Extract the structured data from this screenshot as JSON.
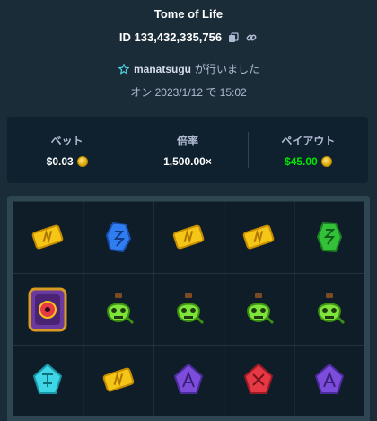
{
  "game": {
    "title": "Tome of Life"
  },
  "bet": {
    "id_label": "ID 133,432,335,756"
  },
  "user": {
    "name": "manatsugu",
    "suffix": "が行いました"
  },
  "date": {
    "text": "オン 2023/1/12 で 15:02"
  },
  "stats": {
    "bet_label": "ベット",
    "bet_value": "$0.03",
    "multiplier_label": "倍率",
    "multiplier_value": "1,500.00×",
    "payout_label": "ペイアウト",
    "payout_value": "$45.00"
  },
  "colors": {
    "background": "#1a2c38",
    "panel": "#0f212e",
    "payout": "#00e701"
  },
  "reels": [
    [
      "gold-rune-icon",
      "book-tome-icon",
      "cyan-rune-icon"
    ],
    [
      "blue-rune-icon",
      "green-skull-potion-icon",
      "gold-rune-icon"
    ],
    [
      "gold-rune-icon",
      "green-skull-potion-icon",
      "purple-rune-icon"
    ],
    [
      "gold-rune-icon",
      "green-skull-potion-icon",
      "red-rune-icon"
    ],
    [
      "green-rune-icon",
      "green-skull-potion-icon",
      "purple-rune-icon"
    ]
  ]
}
